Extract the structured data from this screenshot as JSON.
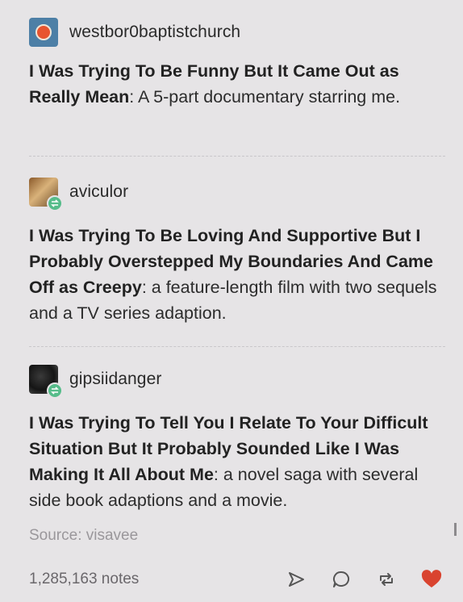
{
  "posts": [
    {
      "username": "westbor0baptistchurch",
      "title_bold": "I Was Trying To Be Funny But It Came Out as Really Mean",
      "rest": ": A 5-part documentary starring me."
    },
    {
      "username": "aviculor",
      "title_bold": "I Was Trying To Be Loving And Supportive But I Probably Overstepped My Boundaries And Came Off as Creepy",
      "rest": ": a feature-length film with two sequels and a TV series adaption."
    },
    {
      "username": "gipsiidanger",
      "title_bold": "I Was Trying To Tell You I Relate To Your Dif­ficult Situation But It Probably Sounded Like I Was Making It All About Me",
      "rest": ": a novel saga with several side book adaptions and a movie."
    }
  ],
  "source": "Source: visavee",
  "notes": "1,285,163 notes",
  "icons": {
    "share": "share-icon",
    "reply": "reply-icon",
    "reblog": "reblog-icon",
    "like": "heart-icon"
  },
  "colors": {
    "background": "#e6e4e6",
    "like": "#d9432f",
    "reblog_badge": "#56bc8a"
  }
}
